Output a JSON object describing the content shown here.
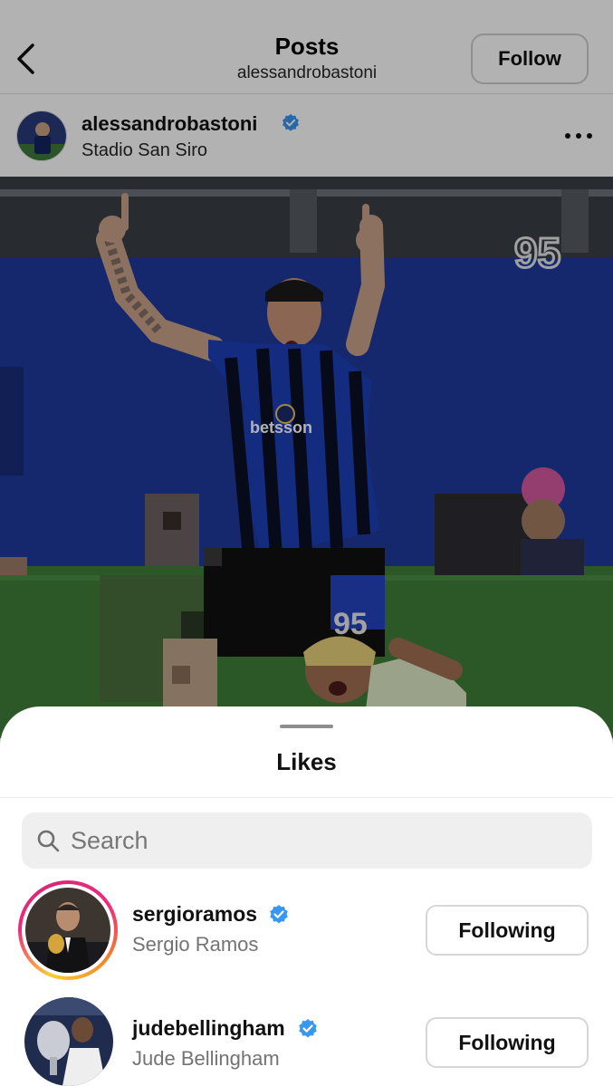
{
  "header": {
    "title": "Posts",
    "subtitle": "alessandrobastoni",
    "follow_label": "Follow"
  },
  "post": {
    "author": "alessandrobastoni",
    "location": "Stadio San Siro",
    "jersey_number": "95",
    "sponsor": "betsson"
  },
  "likes_sheet": {
    "title": "Likes",
    "search_placeholder": "Search",
    "users": [
      {
        "handle": "sergioramos",
        "full_name": "Sergio Ramos",
        "verified": true,
        "button_label": "Following",
        "story_ring": true
      },
      {
        "handle": "judebellingham",
        "full_name": "Jude Bellingham",
        "verified": true,
        "button_label": "Following",
        "story_ring": false
      }
    ]
  },
  "colors": {
    "verified": "#3897f0",
    "inter_blue": "#1d3fb8",
    "pitch_green": "#3f7f3a"
  },
  "icons": [
    "back-chevron-icon",
    "verified-icon",
    "more-icon",
    "search-icon",
    "watermark-95-icon"
  ]
}
